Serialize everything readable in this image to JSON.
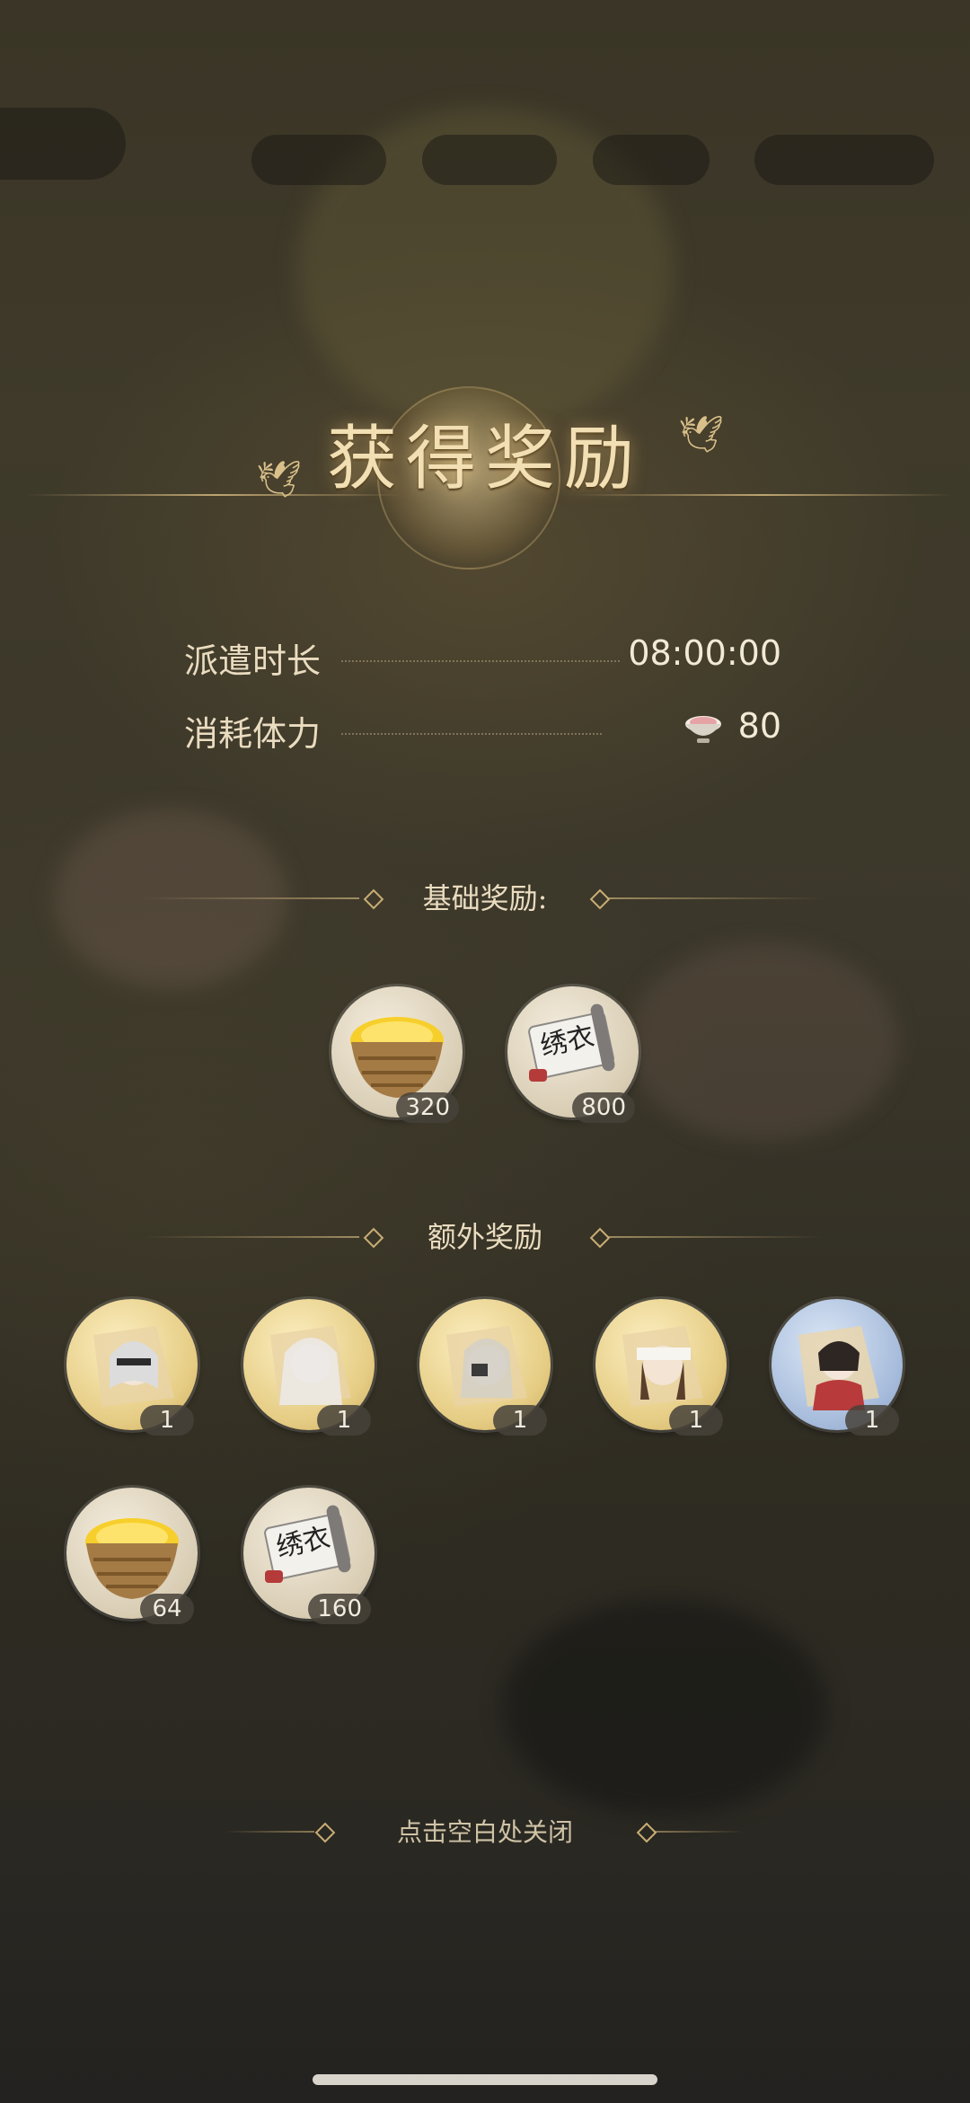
{
  "title": "获得奖励",
  "info": {
    "duration_label": "派遣时长",
    "duration_value": "08:00:00",
    "stamina_label": "消耗体力",
    "stamina_value": "80",
    "stamina_icon": "rice-bowl-icon"
  },
  "basic_rewards": {
    "heading": "基础奖励:",
    "items": [
      {
        "icon": "grain-basket-icon",
        "count": "320"
      },
      {
        "icon": "embroidery-scroll-icon",
        "count": "800",
        "scroll_text": "绣衣"
      }
    ]
  },
  "extra_rewards": {
    "heading": "额外奖励",
    "items": [
      {
        "icon": "character-portrait-icon",
        "count": "1",
        "style": "gold"
      },
      {
        "icon": "character-portrait-icon",
        "count": "1",
        "style": "gold"
      },
      {
        "icon": "character-portrait-icon",
        "count": "1",
        "style": "gold"
      },
      {
        "icon": "character-portrait-icon",
        "count": "1",
        "style": "gold"
      },
      {
        "icon": "character-portrait-icon",
        "count": "1",
        "style": "blue"
      },
      {
        "icon": "grain-basket-icon",
        "count": "64"
      },
      {
        "icon": "embroidery-scroll-icon",
        "count": "160",
        "scroll_text": "绣衣"
      }
    ]
  },
  "close_hint": "点击空白处关闭"
}
